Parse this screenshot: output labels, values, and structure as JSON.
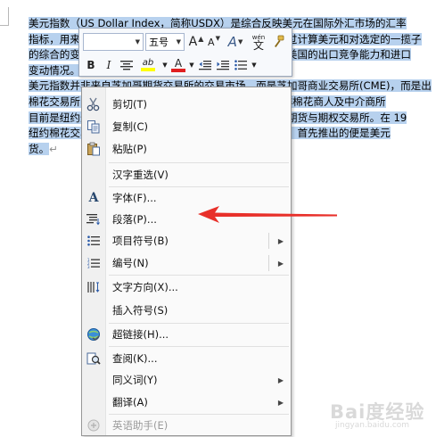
{
  "document": {
    "lines": [
      {
        "text": "美元指数（US Dollar Index，简称USDX）是综合反映美元在国际外汇市场的汇率",
        "sel": true
      },
      {
        "text": "指标，用来衡量美元对一揽子货币的汇率变化程度。它通过计算美元和对选定的一揽子",
        "sel": true
      },
      {
        "text": "的综合的变化率，来衡量美元的强弱程度，从而间接反映美国的出口竞争能力和进口",
        "sel": true
      },
      {
        "text": "变动情况。",
        "sel": true,
        "pm": true
      },
      {
        "text": "美元指数并非来自芝加哥期货交易所的交易市场，而是芝加哥商业交易所(CME)，而是出",
        "sel": true
      },
      {
        "text": "棉花交易所，纽约棉花交易所是在1870年，由早期由一群棉花商人及中介商所",
        "sel": true
      },
      {
        "text": "目前是纽约最古老的商品交易所，并且是全球最重要棉花期货与期权交易所。在 19",
        "sel": true
      },
      {
        "text": "纽约棉花交易所开始建立金融期货市场，即纽约商品市场，首先推出的便是美元",
        "sel": true
      },
      {
        "text": "货。",
        "sel": true,
        "pm": true
      }
    ],
    "paragraph_mark": "↵"
  },
  "mini_toolbar": {
    "font_name": "",
    "font_size": "五号",
    "grow_font": "A",
    "shrink_font": "A",
    "styles": "A",
    "phonetic": "wén",
    "phonetic_char": "文",
    "bold": "B",
    "italic": "I",
    "font_color": "A",
    "highlight": "ab"
  },
  "context_menu": {
    "items": [
      {
        "label": "剪切(T)",
        "icon": "scissors-icon"
      },
      {
        "label": "复制(C)",
        "icon": "copy-icon"
      },
      {
        "label": "粘贴(P)",
        "icon": "paste-icon"
      },
      {
        "label": "汉字重选(V)",
        "icon": ""
      },
      {
        "label": "字体(F)...",
        "icon": "font-icon"
      },
      {
        "label": "段落(P)...",
        "icon": "paragraph-icon"
      },
      {
        "label": "项目符号(B)",
        "icon": "bullets-icon",
        "submenu": true
      },
      {
        "label": "编号(N)",
        "icon": "numbering-icon",
        "submenu": true
      },
      {
        "label": "文字方向(X)...",
        "icon": "text-direction-icon"
      },
      {
        "label": "插入符号(S)",
        "icon": ""
      },
      {
        "label": "超链接(H)...",
        "icon": "hyperlink-icon"
      },
      {
        "label": "查阅(K)...",
        "icon": "research-icon"
      },
      {
        "label": "同义词(Y)",
        "icon": "",
        "submenu": true
      },
      {
        "label": "翻译(A)",
        "icon": "",
        "submenu": true
      },
      {
        "label": "英语助手(E)",
        "icon": "english-assistant-icon",
        "disabled": true
      }
    ]
  },
  "watermark": {
    "brand": "Bai度经验",
    "sub": "jingyan.baidu.com"
  },
  "colors": {
    "selection": "#b7d1ee",
    "arrow": "#e8302a",
    "font_color_bar": "#e02020",
    "highlight_bar": "#ffff00"
  }
}
